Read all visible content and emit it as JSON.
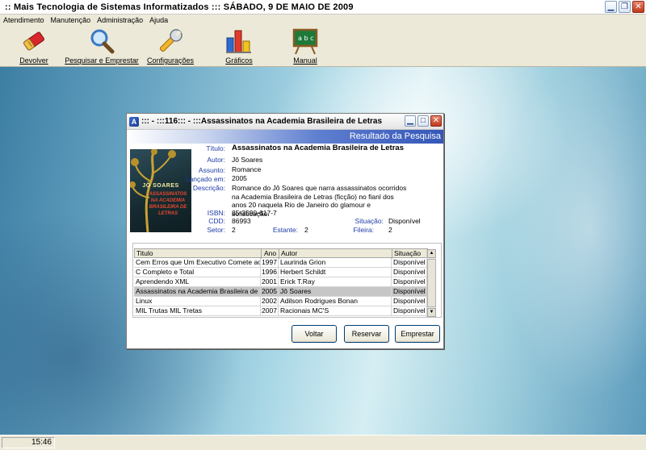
{
  "app": {
    "title": ":: Mais Tecnologia de Sistemas Informatizados ::: SÁBADO, 9 DE MAIO DE 2009"
  },
  "menu": [
    "Atendimento",
    "Manutenção",
    "Administração",
    "Ajuda"
  ],
  "toolbar": [
    {
      "label": "Devolver",
      "icon": "eraser-icon"
    },
    {
      "label": "Pesquisar e Emprestar",
      "icon": "magnifier-icon"
    },
    {
      "label": "Configurações",
      "icon": "wrench-icon"
    },
    {
      "label": "Gráficos",
      "icon": "bar-chart-icon"
    },
    {
      "label": "Manual",
      "icon": "chalkboard-icon"
    }
  ],
  "dialog": {
    "title": "::: - :::116::: - :::Assassinatos na Academia Brasileira de Letras",
    "header": "Resultado da Pesquisa",
    "cover": {
      "author": "JÔ SOARES",
      "title": "ASSASSINATOS NA ACADEMIA BRASILEIRA DE LETRAS"
    },
    "fields": {
      "titulo": {
        "label": "Título:",
        "value": "Assassinatos na Academia Brasileira de Letras"
      },
      "autor": {
        "label": "Autor:",
        "value": "Jô Soares"
      },
      "assunto": {
        "label": "Assunto:",
        "value": "Romance"
      },
      "lancado": {
        "label": "Lançado em:",
        "value": "2005"
      },
      "descricao": {
        "label": "Descrição:",
        "value": "Romance do Jô Soares que narra assassinatos ocorridos na Academia Brasileira de Letras (ficção) no fianl dos anos 20 naquela Rio de Janeiro do glamour e sofisticação."
      },
      "isbn": {
        "label": "ISBN:",
        "value": "85-3590-617-7"
      },
      "cdd": {
        "label": "CDD:",
        "value": "86993"
      },
      "setor": {
        "label": "Setor:",
        "value": "2"
      },
      "estante": {
        "label": "Estante:",
        "value": "2"
      },
      "situacao": {
        "label": "Situação:",
        "value": "Disponível"
      },
      "fileira": {
        "label": "Fileira:",
        "value": "2"
      }
    },
    "table": {
      "columns": [
        "Titulo",
        "Ano",
        "Autor",
        "Situação"
      ],
      "rows": [
        {
          "titulo": "Cem Erros que Um Executivo Comete ao",
          "ano": "1997",
          "autor": "Laurinda Grion",
          "situacao": "Disponível"
        },
        {
          "titulo": "C Completo e Total",
          "ano": "1996",
          "autor": "Herbert Schildt",
          "situacao": "Disponível"
        },
        {
          "titulo": "Aprendendo XML",
          "ano": "2001",
          "autor": "Erick T.Ray",
          "situacao": "Disponível"
        },
        {
          "titulo": "Assassinatos na Academia Brasileira de",
          "ano": "2005",
          "autor": "Jô Soares",
          "situacao": "Disponível"
        },
        {
          "titulo": "Linux",
          "ano": "2002",
          "autor": "Adilson Rodrigues Bonan",
          "situacao": "Disponível"
        },
        {
          "titulo": "MIL Trutas MIL Tretas",
          "ano": "2007",
          "autor": "Racionais MC'S",
          "situacao": "Disponível"
        }
      ]
    },
    "buttons": {
      "voltar": "Voltar",
      "reservar": "Reservar",
      "emprestar": "Emprestar"
    }
  },
  "status": {
    "time": "15:46"
  },
  "colors": {
    "accent": "#3457b8",
    "label_blue": "#1d3ba8"
  }
}
